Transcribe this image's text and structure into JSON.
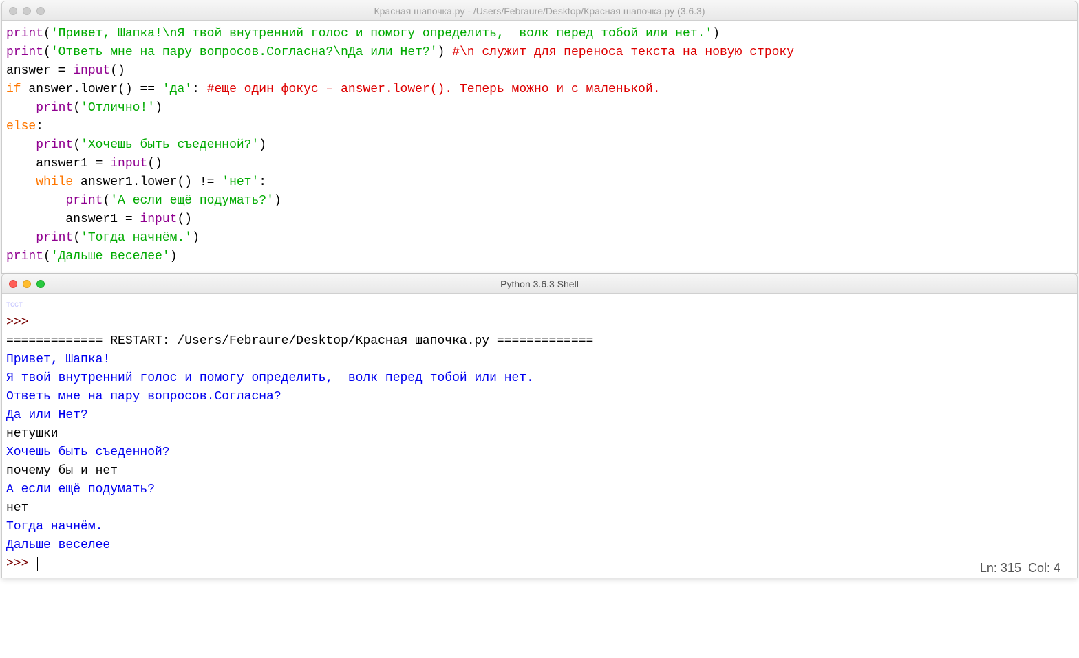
{
  "editor": {
    "title": "Красная шапочка.py - /Users/Febraure/Desktop/Красная шапочка.py (3.6.3)",
    "code": {
      "l1a": "print",
      "l1b": "(",
      "l1c": "'Привет, Шапка!\\nЯ твой внутренний голос и помогу определить,  волк перед тобой или нет.'",
      "l1d": ")",
      "l2a": "print",
      "l2b": "(",
      "l2c": "'Ответь мне на пару вопросов.Согласна?\\nДа или Нет?'",
      "l2d": ") ",
      "l2e": "#\\n служит для переноса текста на новую строку",
      "l3a": "answer = ",
      "l3b": "input",
      "l3c": "()",
      "l4a": "if",
      "l4b": " answer.lower() == ",
      "l4c": "'да'",
      "l4d": ": ",
      "l4e": "#еще один фокус – answer.lower(). Теперь можно и с маленькой.",
      "l5a": "    ",
      "l5b": "print",
      "l5c": "(",
      "l5d": "'Отлично!'",
      "l5e": ")",
      "l6a": "else",
      "l6b": ":",
      "l7a": "    ",
      "l7b": "print",
      "l7c": "(",
      "l7d": "'Хочешь быть съеденной?'",
      "l7e": ")",
      "l8a": "    answer1 = ",
      "l8b": "input",
      "l8c": "()",
      "l9a": "    ",
      "l9b": "while",
      "l9c": " answer1.lower() != ",
      "l9d": "'нет'",
      "l9e": ":",
      "l10a": "        ",
      "l10b": "print",
      "l10c": "(",
      "l10d": "'А если ещё подумать?'",
      "l10e": ")",
      "l11a": "        answer1 = ",
      "l11b": "input",
      "l11c": "()",
      "l12a": "    ",
      "l12b": "print",
      "l12c": "(",
      "l12d": "'Тогда начнём.'",
      "l12e": ")",
      "l13a": "print",
      "l13b": "(",
      "l13c": "'Дальше веселее'",
      "l13d": ")"
    }
  },
  "shell": {
    "title": "Python 3.6.3 Shell",
    "truncated_top": "TCCT",
    "prompt": ">>> ",
    "restart": "============= RESTART: /Users/Febraure/Desktop/Красная шапочка.py =============",
    "out1": "Привет, Шапка!",
    "out2": "Я твой внутренний голос и помогу определить,  волк перед тобой или нет.",
    "out3": "Ответь мне на пару вопросов.Согласна?",
    "out4": "Да или Нет?",
    "in1": "нетушки",
    "out5": "Хочешь быть съеденной?",
    "in2": "почему бы и нет",
    "out6": "А если ещё подумать?",
    "in3": "нет",
    "out7": "Тогда начнём.",
    "out8": "Дальше веселее",
    "status": "Ln: 315  Col: 4"
  }
}
